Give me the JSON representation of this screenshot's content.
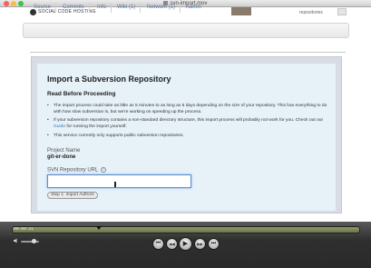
{
  "window": {
    "title": "svn-import.mov",
    "traffic_lights": [
      "#fc605c",
      "#fdbc40",
      "#34c84a"
    ]
  },
  "header": {
    "logo_text": "SOCIAL CODE HOSTING",
    "repos_text": "repositories"
  },
  "tabs": [
    {
      "label": "Source"
    },
    {
      "label": "Commits"
    },
    {
      "label": "Info"
    },
    {
      "label": "Wiki (1)"
    },
    {
      "label": "Network (1)"
    },
    {
      "label": "Admin"
    }
  ],
  "import": {
    "title": "Import a Subversion Repository",
    "subtitle": "Read Before Proceeding",
    "bullet1": "The import process could take as little as 5 minutes to as long as 5 days depending on the size of your repository. This has everything to do with how slow subversion is, but we're working on speeding up the process.",
    "bullet2_before": "If your subversion repository contains a non-standard directory structure, this import process will probably not work for you. Check out our ",
    "bullet2_link": "Guide",
    "bullet2_after": " for running the import yourself.",
    "bullet3": "This service currently only supports public subversion repositories.",
    "project_label": "Project Name",
    "project_value": "git-er-done",
    "url_label": "SVN Repository URL",
    "help_glyph": "?",
    "url_value": "",
    "step_button": "Step 1: Import Authors"
  },
  "player": {
    "timecode": "00:00:21",
    "progress_fraction": 0.25,
    "volume_fraction": 0.7,
    "controls": [
      {
        "name": "rewind-end-button",
        "icon": "skip-back-icon",
        "glyph": "⏮"
      },
      {
        "name": "rewind-button",
        "icon": "rewind-icon",
        "glyph": "◀◀"
      },
      {
        "name": "play-button",
        "icon": "play-icon",
        "glyph": "▶"
      },
      {
        "name": "fast-forward-button",
        "icon": "fast-forward-icon",
        "glyph": "▶▶"
      },
      {
        "name": "skip-end-button",
        "icon": "skip-forward-icon",
        "glyph": "⏭"
      }
    ]
  },
  "colors": {
    "accent_link": "#3b73b9",
    "panel_bg": "#e6f1f8",
    "input_focus": "#5f8fc8"
  }
}
